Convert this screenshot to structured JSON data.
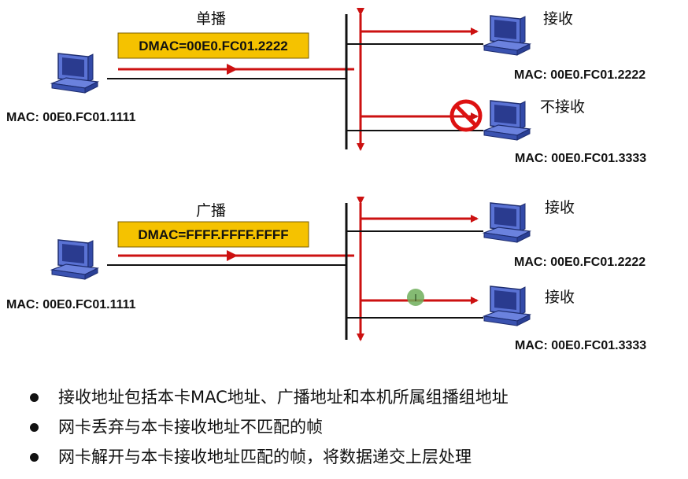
{
  "unicast": {
    "title": "单播",
    "dmac": "DMAC=00E0.FC01.2222",
    "sender_mac": "MAC: 00E0.FC01.1111",
    "receivers": [
      {
        "status": "接收",
        "mac": "MAC: 00E0.FC01.2222"
      },
      {
        "status": "不接收",
        "mac": "MAC: 00E0.FC01.3333"
      }
    ]
  },
  "broadcast": {
    "title": "广播",
    "dmac": "DMAC=FFFF.FFFF.FFFF",
    "sender_mac": "MAC: 00E0.FC01.1111",
    "receivers": [
      {
        "status": "接收",
        "mac": "MAC: 00E0.FC01.2222"
      },
      {
        "status": "接收",
        "mac": "MAC: 00E0.FC01.3333"
      }
    ]
  },
  "bullets": [
    "接收地址包括本卡MAC地址、广播地址和本机所属组播组地址",
    "网卡丢弃与本卡接收地址不匹配的帧",
    "网卡解开与本卡接收地址匹配的帧，将数据递交上层处理"
  ],
  "colors": {
    "arrow": "#cc1111",
    "label_box": "#f5c200",
    "computer": "#4a63c9"
  },
  "icons": [
    "computer-icon",
    "no-entry-icon",
    "cursor-dot-icon"
  ]
}
